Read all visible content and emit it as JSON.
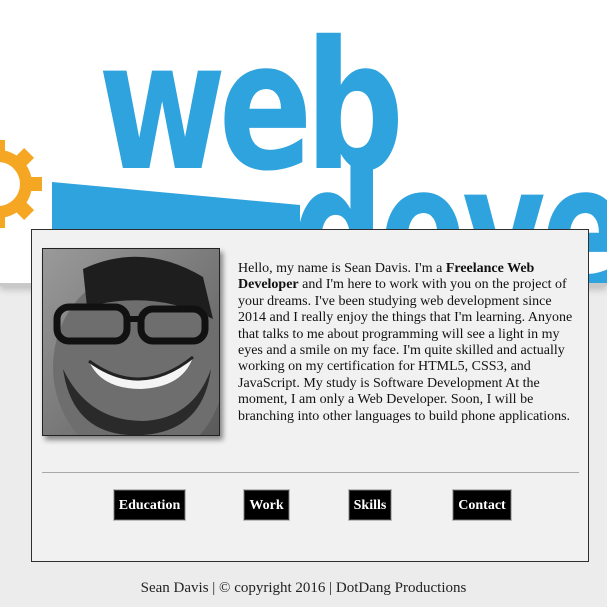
{
  "hero": {
    "word_top": "web",
    "word_bottom": "devel",
    "brand_blue": "#2ea3de",
    "gear_color": "#f5a623",
    "gear_icon": "gear-icon"
  },
  "profile": {
    "photo_alt": "Portrait of Sean Davis",
    "intro_before": "Hello, my name is Sean Davis. I'm a ",
    "intro_strong": "Freelance Web Developer",
    "intro_after": " and I'm here to work with you on the project of your dreams. I've been studying web development since 2014 and I really enjoy the things that I'm learning. Anyone that talks to me about programming will see a light in my eyes and a smile on my face. I'm quite skilled and actually working on my certification for HTML5, CSS3, and JavaScript. My study is Software Development At the moment, I am only a Web Developer. Soon, I will be branching into other languages to build phone applications."
  },
  "nav": {
    "education": "Education",
    "work": "Work",
    "skills": "Skills",
    "contact": "Contact"
  },
  "footer": {
    "text": "Sean Davis | © copyright 2016 | DotDang Productions"
  }
}
